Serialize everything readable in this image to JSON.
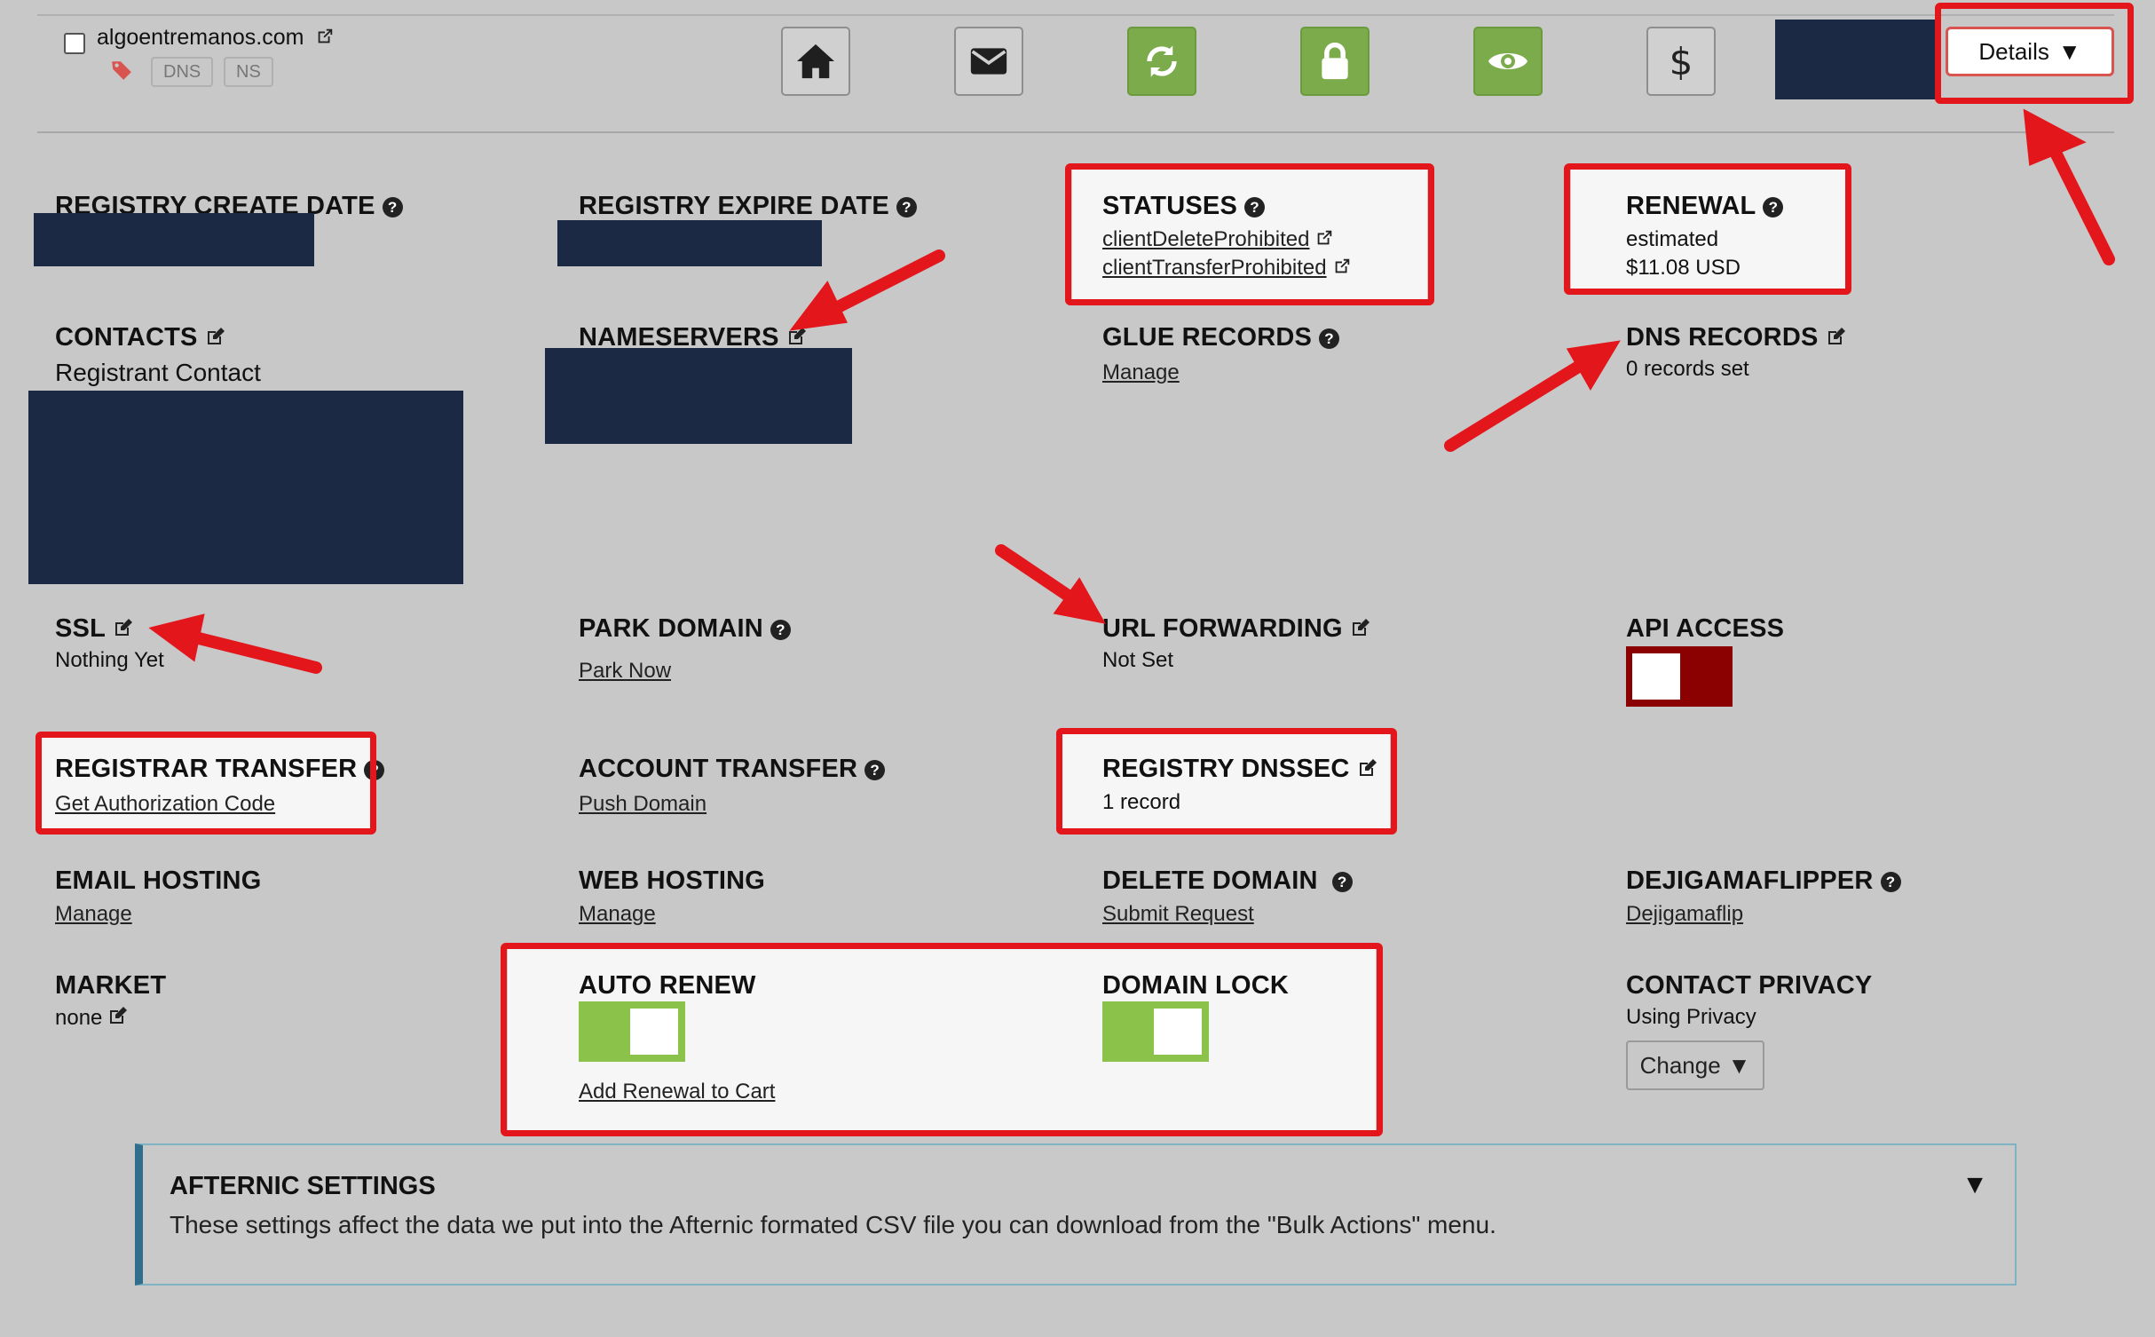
{
  "domain": {
    "name": "algoentremanos.com",
    "chips": [
      "DNS",
      "NS"
    ]
  },
  "toolbar": {
    "icons": [
      "home-icon",
      "envelope-icon",
      "refresh-icon",
      "lock-icon",
      "eye-icon",
      "dollar-icon"
    ],
    "dollar_glyph": "$",
    "details_label": "Details",
    "details_caret": "▼"
  },
  "fields": {
    "registry_create_date": {
      "label": "REGISTRY CREATE DATE"
    },
    "registry_expire_date": {
      "label": "REGISTRY EXPIRE DATE"
    },
    "statuses": {
      "label": "STATUSES",
      "items": [
        "clientDeleteProhibited",
        "clientTransferProhibited"
      ]
    },
    "renewal": {
      "label": "RENEWAL",
      "line1": "estimated",
      "line2": "$11.08 USD"
    },
    "contacts": {
      "label": "CONTACTS",
      "value": "Registrant Contact"
    },
    "nameservers": {
      "label": "NAMESERVERS"
    },
    "glue_records": {
      "label": "GLUE RECORDS",
      "link": "Manage"
    },
    "dns_records": {
      "label": "DNS RECORDS",
      "value": "0 records set"
    },
    "ssl": {
      "label": "SSL",
      "value": "Nothing Yet"
    },
    "park_domain": {
      "label": "PARK DOMAIN",
      "link": "Park Now"
    },
    "url_forwarding": {
      "label": "URL FORWARDING",
      "value": "Not Set"
    },
    "api_access": {
      "label": "API ACCESS",
      "enabled": false
    },
    "registrar_transfer": {
      "label": "REGISTRAR TRANSFER",
      "link": "Get Authorization Code"
    },
    "account_transfer": {
      "label": "ACCOUNT TRANSFER",
      "link": "Push Domain"
    },
    "registry_dnssec": {
      "label": "REGISTRY DNSSEC",
      "value": "1 record"
    },
    "email_hosting": {
      "label": "EMAIL HOSTING",
      "link": "Manage"
    },
    "web_hosting": {
      "label": "WEB HOSTING",
      "link": "Manage"
    },
    "delete_domain": {
      "label": "DELETE DOMAIN",
      "link": "Submit Request"
    },
    "dejigamaflipper": {
      "label": "DEJIGAMAFLIPPER",
      "link": "Dejigamaflip"
    },
    "market": {
      "label": "MARKET",
      "value": "none"
    },
    "auto_renew": {
      "label": "AUTO RENEW",
      "enabled": true,
      "link": "Add Renewal to Cart"
    },
    "domain_lock": {
      "label": "DOMAIN LOCK",
      "enabled": true
    },
    "contact_privacy": {
      "label": "CONTACT PRIVACY",
      "value": "Using Privacy",
      "button": "Change",
      "caret": "▼"
    }
  },
  "afternic": {
    "title": "AFTERNIC SETTINGS",
    "description": "These settings affect the data we put into the Afternic formated CSV file you can download from the \"Bulk Actions\" menu.",
    "caret": "▼"
  },
  "colors": {
    "annotation_red": "#e3161c",
    "redaction_navy": "#1b2945",
    "toggle_on": "#8bc34a",
    "toggle_off": "#8b0000",
    "button_green": "#7cab4b"
  }
}
